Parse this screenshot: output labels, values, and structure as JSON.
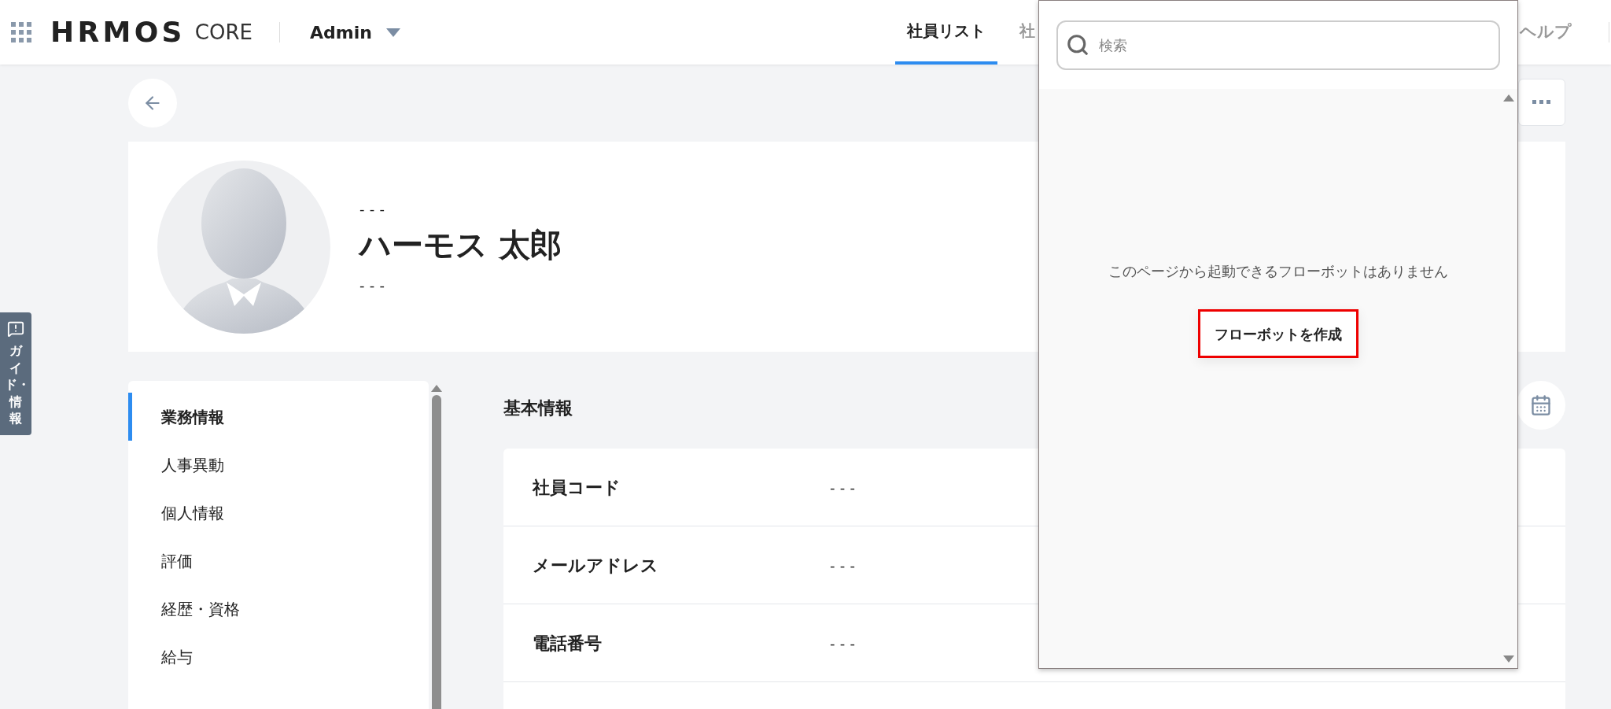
{
  "header": {
    "logo": "HRMOS",
    "product": "CORE",
    "role": "Admin",
    "tabs": [
      {
        "label": "社員リスト",
        "selected": true
      },
      {
        "label": "社",
        "selected": false
      }
    ],
    "help": "ヘルプ"
  },
  "guide_tab": {
    "label": "ガイド・情報"
  },
  "profile": {
    "line_1": "---",
    "name": "ハーモス 太郎",
    "line_2": "---"
  },
  "sidebar": {
    "items": [
      {
        "label": "業務情報",
        "selected": true
      },
      {
        "label": "人事異動",
        "selected": false
      },
      {
        "label": "個人情報",
        "selected": false
      },
      {
        "label": "評価",
        "selected": false
      },
      {
        "label": "経歴・資格",
        "selected": false
      },
      {
        "label": "給与",
        "selected": false
      }
    ]
  },
  "section": {
    "title": "基本情報",
    "fields": [
      {
        "label": "社員コード",
        "value": "---"
      },
      {
        "label": "メールアドレス",
        "value": "---"
      },
      {
        "label": "電話番号",
        "value": "---"
      }
    ]
  },
  "popup": {
    "search": {
      "placeholder": "検索"
    },
    "message": "このページから起動できるフローボットはありません",
    "button": "フローボットを作成"
  }
}
